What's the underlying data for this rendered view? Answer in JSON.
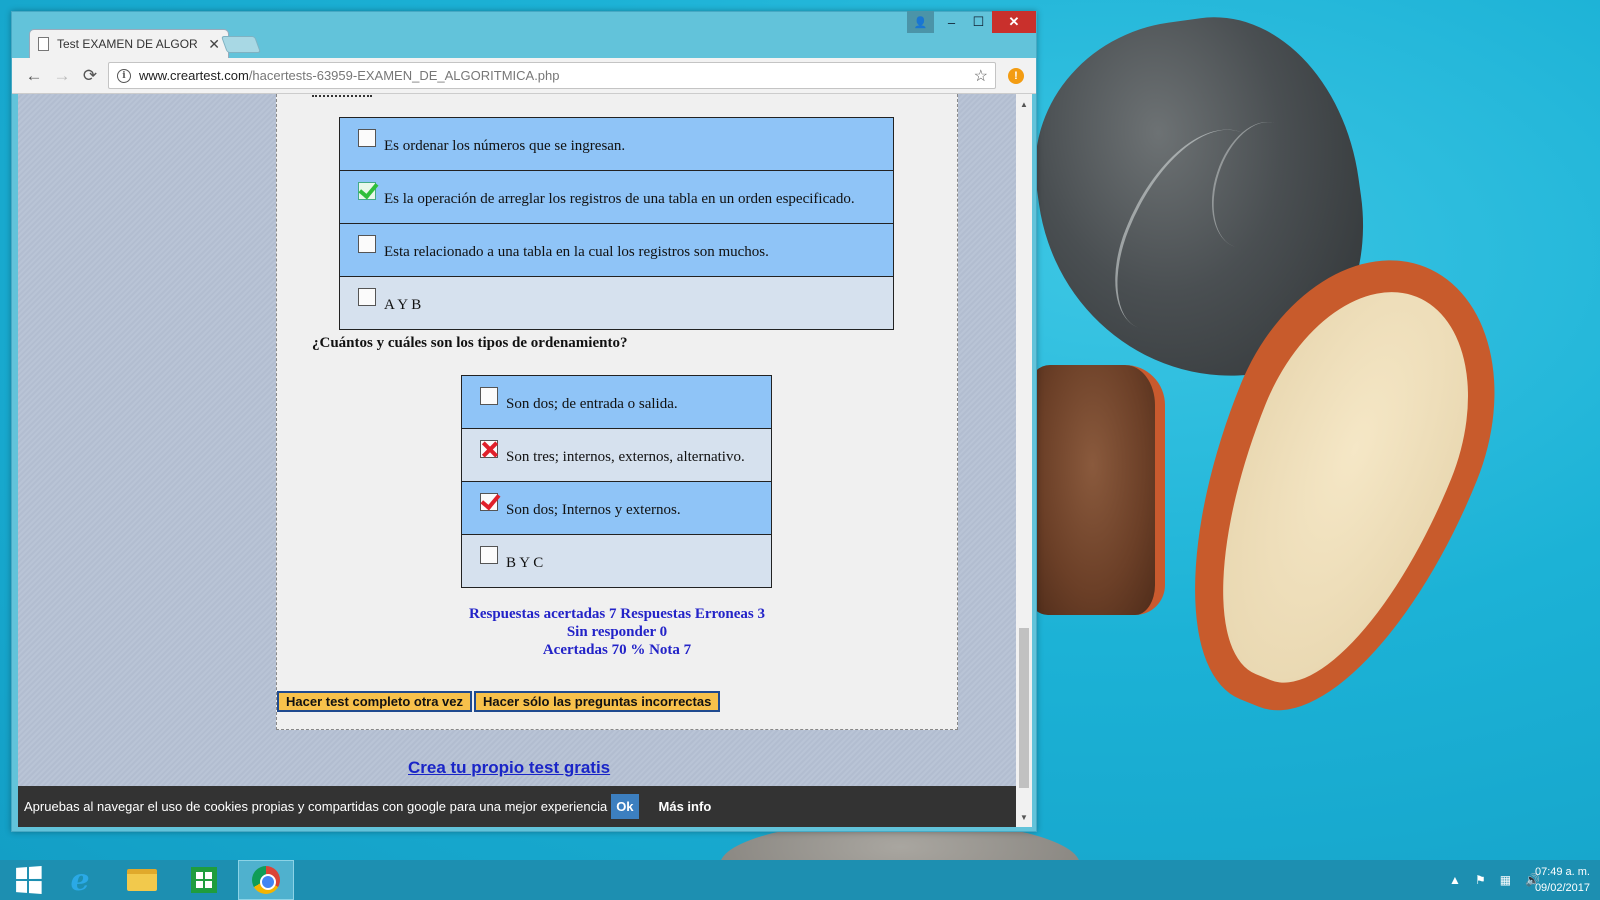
{
  "browser": {
    "tab_title": "Test EXAMEN DE ALGOR",
    "tab_close": "✕",
    "url_host": "www.creartest.com",
    "url_path": "/hacertests-63959-EXAMEN_DE_ALGORITMICA.php",
    "window_controls": {
      "minimize": "–",
      "maximize": "☐",
      "close": "✕",
      "profile": "👤"
    },
    "nav": {
      "back": "←",
      "forward": "→",
      "reload": "⟳",
      "star": "☆",
      "ext": "!"
    }
  },
  "question1": {
    "answers": [
      {
        "text": "Es ordenar los números que se ingresan.",
        "state": "empty",
        "color": "blue"
      },
      {
        "text": "Es la operación de arreglar los registros de una tabla en un orden especificado.",
        "state": "ok",
        "color": "blue"
      },
      {
        "text": "Esta relacionado a una tabla en la cual los registros son muchos.",
        "state": "empty",
        "color": "blue"
      },
      {
        "text": "A Y B",
        "state": "empty",
        "color": "gray"
      }
    ]
  },
  "question2": {
    "title": "¿Cuántos y cuáles son los tipos de ordenamiento?",
    "answers": [
      {
        "text": "Son dos; de entrada o salida.",
        "state": "empty",
        "color": "blue"
      },
      {
        "text": "Son tres; internos, externos, alternativo.",
        "state": "cross",
        "color": "gray"
      },
      {
        "text": "Son dos; Internos y externos.",
        "state": "wrongcheck",
        "color": "blue"
      },
      {
        "text": "B Y C",
        "state": "empty",
        "color": "gray"
      }
    ]
  },
  "results": {
    "line1": "Respuestas acertadas 7 Respuestas Erroneas 3",
    "line2": "Sin responder 0",
    "line3": "Acertadas 70 % Nota 7"
  },
  "buttons": {
    "retry_all": "Hacer test completo otra vez",
    "retry_wrong": "Hacer sólo las preguntas incorrectas"
  },
  "create_link": "Crea tu propio test gratis",
  "cookie_bar": {
    "text": "Apruebas al navegar el uso de cookies propias y compartidas con google para una mejor experiencia",
    "ok": "Ok",
    "more": "Más info"
  },
  "taskbar": {
    "time": "07:49 a. m.",
    "date": "09/02/2017"
  },
  "colors": {
    "answer_blue": "#8fc4f7",
    "answer_gray": "#d6e1ee",
    "result_text": "#2323c8",
    "button_yellow": "#f7c14b",
    "close_red": "#c9302c"
  }
}
